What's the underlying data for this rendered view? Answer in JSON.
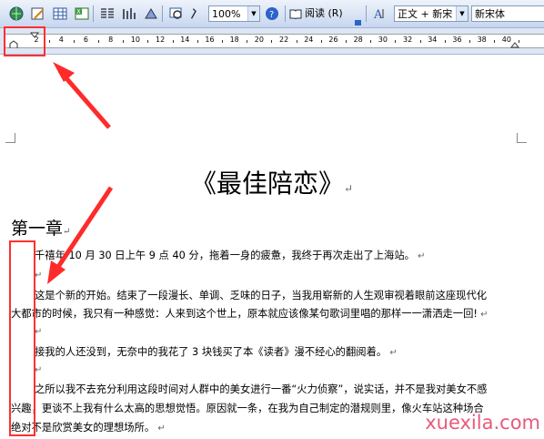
{
  "toolbar": {
    "zoom": "100%",
    "read_label": "阅读",
    "read_accel": "(R)",
    "style": "正文 + 新宋",
    "font": "新宋体"
  },
  "ruler": {
    "marks": [
      "2",
      "4",
      "6",
      "8",
      "10",
      "12",
      "14",
      "16",
      "18",
      "20",
      "22",
      "24",
      "26",
      "28",
      "30",
      "32",
      "34",
      "36",
      "38",
      "40"
    ]
  },
  "document": {
    "title": "《最佳陪恋》",
    "chapter": "第一章",
    "paragraph_mark": "↵",
    "lines": [
      "千禧年 10 月 30 日上午 9 点 40 分，拖着一身的疲惫，我终于再次走出了上海站。",
      "这是个新的开始。结束了一段漫长、单调、乏味的日子，当我用崭新的人生观审视着眼前这座现代化",
      "大都市的时候，我只有一种感觉：人来到这个世上，原本就应该像某句歌词里唱的那样一一潇洒走一回!",
      "接我的人还没到，无奈中的我花了 3 块钱买了本《读者》漫不经心的翻阅着。",
      "之所以我不去充分利用这段时间对人群中的美女进行一番“火力侦察”，说实话，并不是我对美女不感",
      "兴趣，更谈不上我有什么太高的思想觉悟。原因就一条，在我为自己制定的潜规则里，像火车站这种场合",
      "绝对不是欣赏美女的理想场所。"
    ]
  },
  "watermark": "xuexila.com"
}
